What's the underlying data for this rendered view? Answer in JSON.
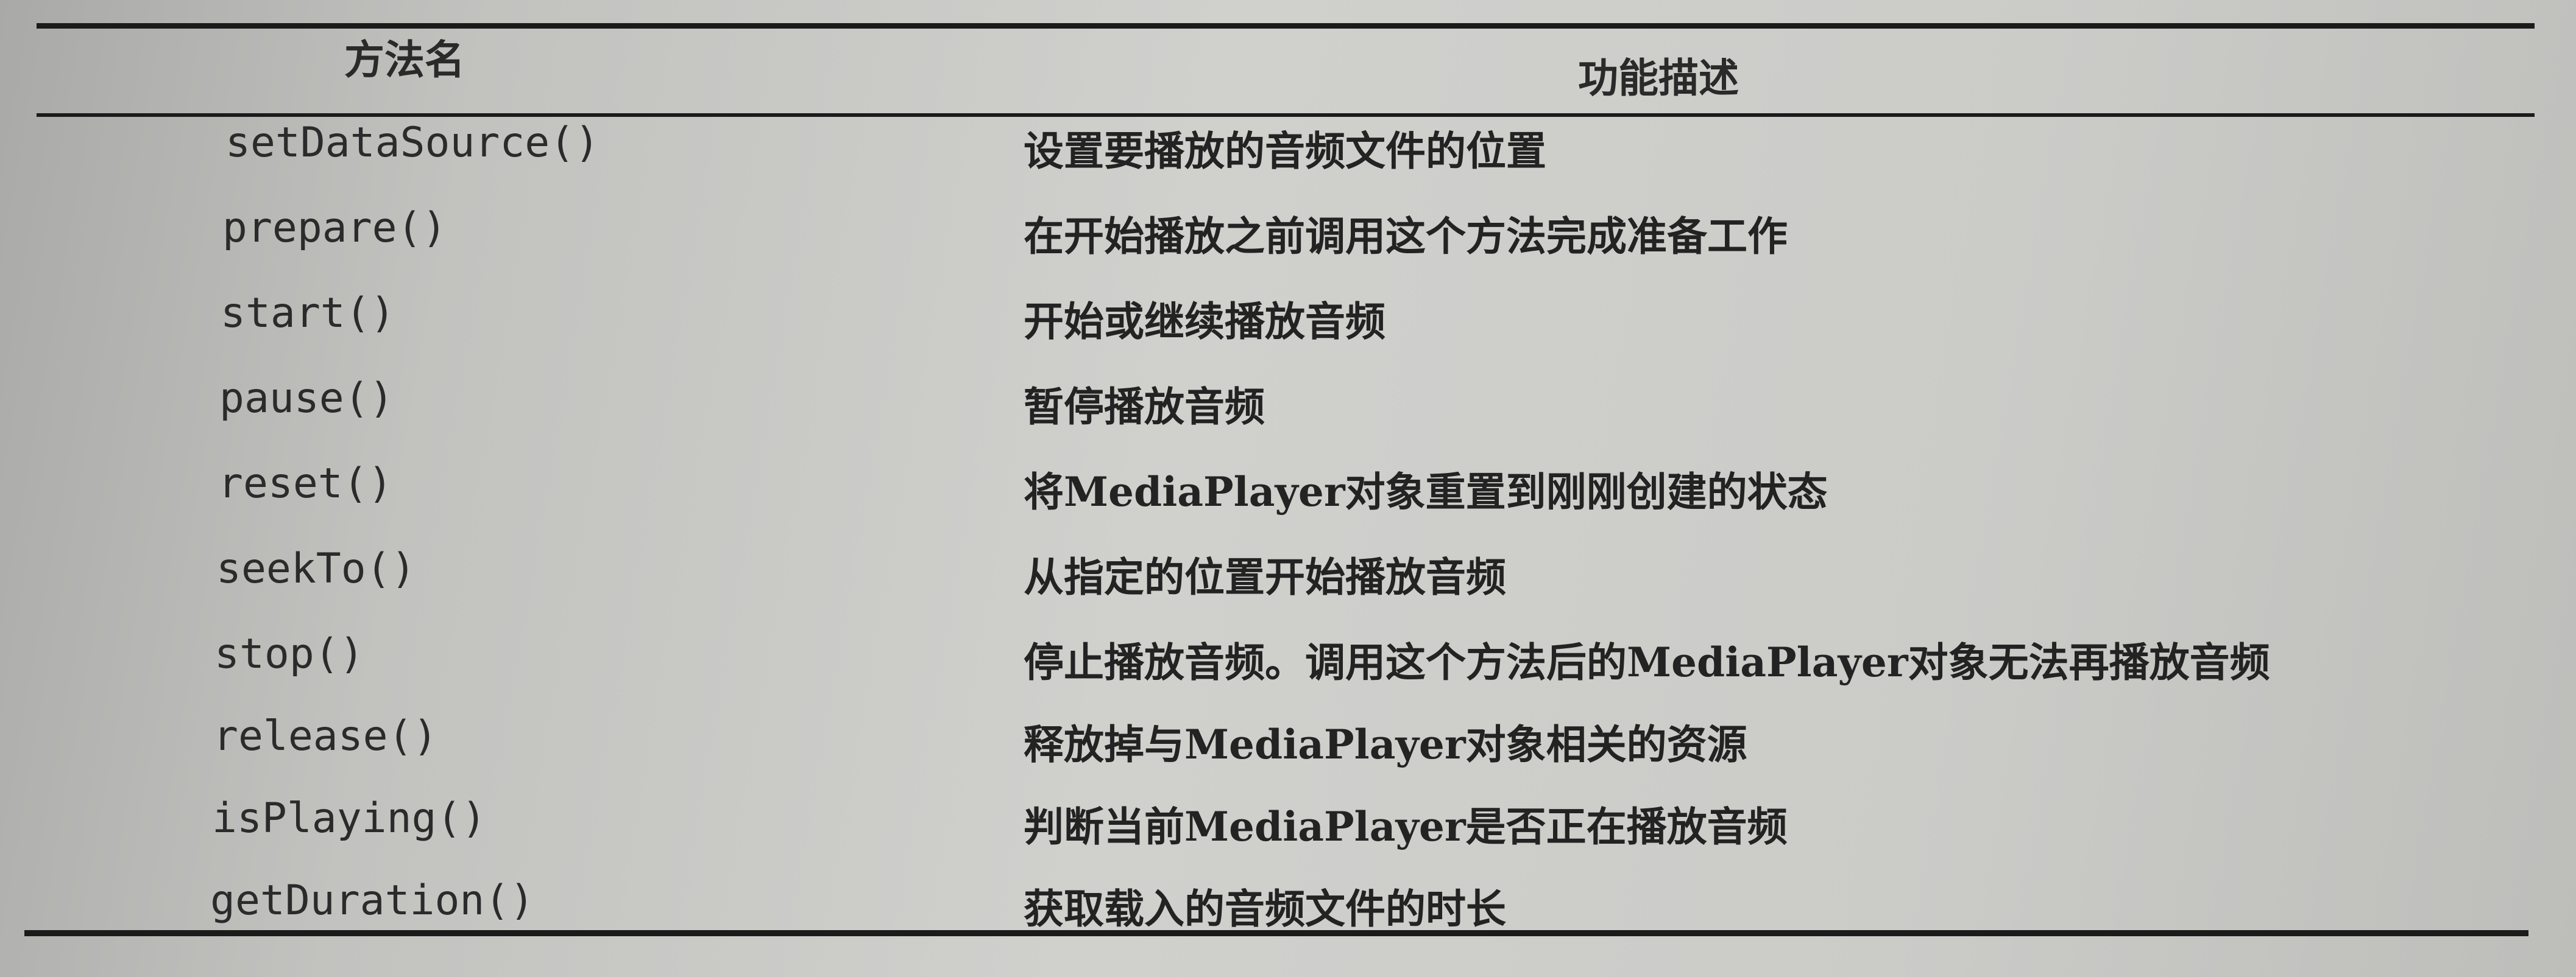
{
  "table": {
    "headers": {
      "method": "方法名",
      "description": "功能描述"
    },
    "rows": [
      {
        "method": "setDataSource()",
        "description": "设置要播放的音频文件的位置"
      },
      {
        "method": "prepare()",
        "description": "在开始播放之前调用这个方法完成准备工作"
      },
      {
        "method": "start()",
        "description": "开始或继续播放音频"
      },
      {
        "method": "pause()",
        "description": "暂停播放音频"
      },
      {
        "method": "reset()",
        "description": "将MediaPlayer对象重置到刚刚创建的状态"
      },
      {
        "method": "seekTo()",
        "description": "从指定的位置开始播放音频"
      },
      {
        "method": "stop()",
        "description": "停止播放音频。调用这个方法后的MediaPlayer对象无法再播放音频"
      },
      {
        "method": "release()",
        "description": "释放掉与MediaPlayer对象相关的资源"
      },
      {
        "method": "isPlaying()",
        "description": "判断当前MediaPlayer是否正在播放音频"
      },
      {
        "method": "getDuration()",
        "description": "获取载入的音频文件的时长"
      }
    ]
  }
}
